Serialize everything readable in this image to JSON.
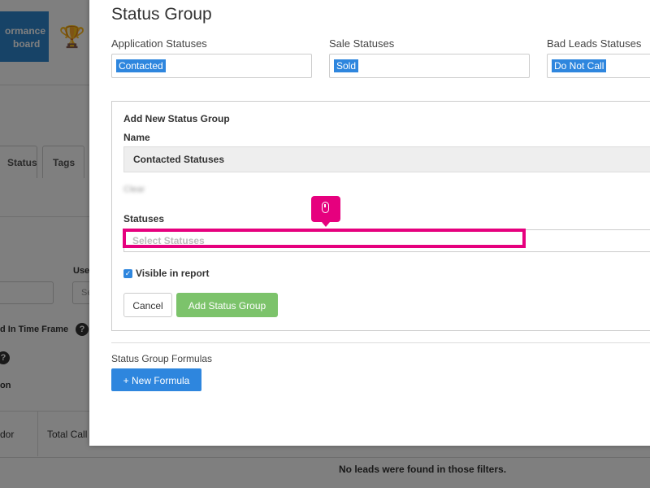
{
  "background": {
    "perf_line1": "ormance",
    "perf_line2": "board",
    "trophy_icon": "trophy-icon",
    "tab_status": "Status",
    "tab_tags": "Tags",
    "user_label": "Use",
    "select_partial": "Se",
    "time_frame_label": "d In Time Frame",
    "help_char": "?",
    "on_label": "on",
    "col_vendor": "dor",
    "col_total_calls": "Total Call",
    "no_leads": "No leads were found in those filters."
  },
  "modal": {
    "title": "Status Group",
    "application_label": "Application Statuses",
    "application_chip": "Contacted",
    "sale_label": "Sale Statuses",
    "sale_chip": "Sold",
    "bad_label": "Bad Leads Statuses",
    "bad_chip": "Do Not Call",
    "group": {
      "title": "Add New Status Group",
      "name_label": "Name",
      "name_value": "Contacted Statuses",
      "blurred_text": "Clear",
      "statuses_label": "Statuses",
      "statuses_placeholder": "Select Statuses",
      "visible_label": "Visible in report",
      "visible_checked": true,
      "cancel_label": "Cancel",
      "add_label": "Add Status Group"
    },
    "formulas_label": "Status Group Formulas",
    "new_formula_label": "+ New Formula"
  },
  "colors": {
    "accent_blue": "#2e86de",
    "green_button": "#7cc36b",
    "highlight_pink": "#e6007e"
  }
}
